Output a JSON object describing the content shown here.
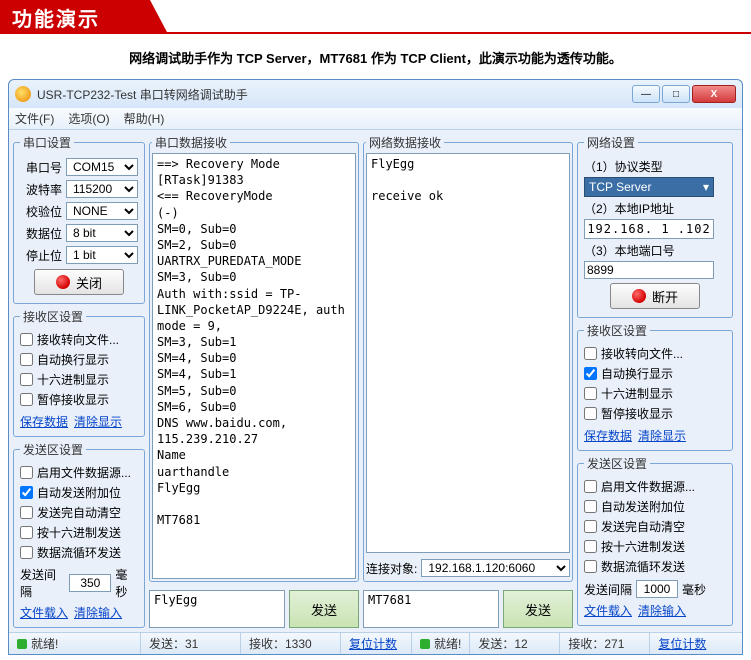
{
  "banner": {
    "title": "功能演示"
  },
  "subtitle": "网络调试助手作为 TCP Server，MT7681 作为 TCP Client，此演示功能为透传功能。",
  "window": {
    "title": "USR-TCP232-Test 串口转网络调试助手",
    "btn_min": "—",
    "btn_max": "□",
    "btn_close": "X"
  },
  "menu": {
    "file": "文件(F)",
    "options": "选项(O)",
    "help": "帮助(H)"
  },
  "serial": {
    "legend": "串口设置",
    "port_lbl": "串口号",
    "port": "COM15",
    "baud_lbl": "波特率",
    "baud": "115200",
    "parity_lbl": "校验位",
    "parity": "NONE",
    "data_lbl": "数据位",
    "data": "8 bit",
    "stop_lbl": "停止位",
    "stop": "1 bit",
    "btn": "关闭"
  },
  "rx_set": {
    "legend": "接收区设置",
    "c1": "接收转向文件...",
    "c2": "自动换行显示",
    "c3": "十六进制显示",
    "c4": "暂停接收显示",
    "link_save": "保存数据",
    "link_clear": "清除显示"
  },
  "tx_set": {
    "legend": "发送区设置",
    "c1": "启用文件数据源...",
    "c2": "自动发送附加位",
    "c3": "发送完自动清空",
    "c4": "按十六进制发送",
    "c5": "数据流循环发送",
    "interval_lbl": "发送间隔",
    "interval_l": "350",
    "interval_r": "1000",
    "ms": "毫秒",
    "link_load": "文件载入",
    "link_clear": "清除输入"
  },
  "mid1": {
    "legend": "串口数据接收",
    "text": "==> Recovery Mode\n[RTask]91383\n<== RecoveryMode\n(-)\nSM=0, Sub=0\nSM=2, Sub=0\nUARTRX_PUREDATA_MODE\nSM=3, Sub=0\nAuth with:ssid = TP-LINK_PocketAP_D9224E, auth mode = 9,\nSM=3, Sub=1\nSM=4, Sub=0\nSM=4, Sub=1\nSM=5, Sub=0\nSM=6, Sub=0\nDNS www.baidu.com, 115.239.210.27\nName\nuarthandle\nFlyEgg\n\nMT7681",
    "send_val": "FlyEgg",
    "send_btn": "发送"
  },
  "mid2": {
    "legend": "网络数据接收",
    "text": "FlyEgg\n\nreceive ok",
    "conn_lbl": "连接对象:",
    "conn_val": "192.168.1.120:6060",
    "send_val": "MT7681",
    "send_btn": "发送"
  },
  "net": {
    "legend": "网络设置",
    "proto_lbl": "（1）协议类型",
    "proto": "TCP Server",
    "ip_lbl": "（2）本地IP地址",
    "ip": "192.168. 1 .102",
    "port_lbl": "（3）本地端口号",
    "port": "8899",
    "btn": "断开"
  },
  "rx_set2": {
    "legend": "接收区设置",
    "c1": "接收转向文件...",
    "c2": "自动换行显示",
    "c3": "十六进制显示",
    "c4": "暂停接收显示"
  },
  "tx_set2": {
    "legend": "发送区设置"
  },
  "status": {
    "ready": "就绪!",
    "tx_l": "发送：31",
    "rx_l": "接收：1330",
    "reset_l": "复位计数",
    "tx_r": "发送：12",
    "rx_r": "接收：271",
    "reset_r": "复位计数"
  }
}
